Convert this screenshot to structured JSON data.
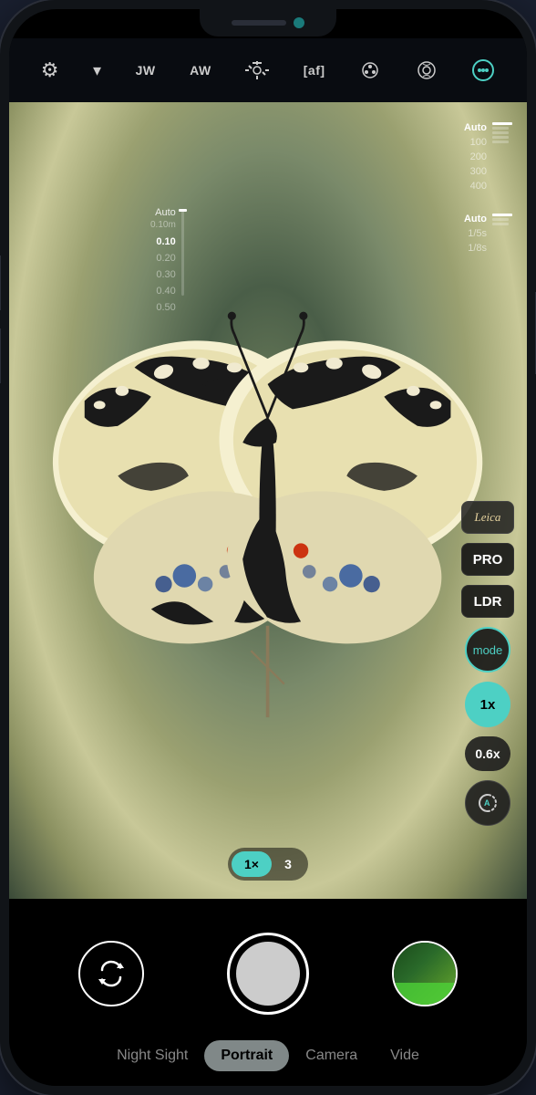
{
  "phone": {
    "notch": {
      "speaker_label": "speaker",
      "camera_label": "front-camera"
    }
  },
  "toolbar": {
    "icons": [
      {
        "id": "settings",
        "symbol": "⚙",
        "label": "Settings",
        "active": false
      },
      {
        "id": "dropdown",
        "symbol": "▾",
        "label": "Dropdown",
        "active": false
      },
      {
        "id": "jw",
        "symbol": "JW",
        "label": "White Balance JW",
        "active": false
      },
      {
        "id": "aw",
        "symbol": "AW",
        "label": "Auto White AW",
        "active": false
      },
      {
        "id": "exposure",
        "symbol": "☀",
        "label": "Exposure",
        "active": false
      },
      {
        "id": "af",
        "symbol": "[af]",
        "label": "Autofocus",
        "active": false
      },
      {
        "id": "macro",
        "symbol": "✿",
        "label": "Macro",
        "active": false
      },
      {
        "id": "lens",
        "symbol": "◉",
        "label": "Lens",
        "active": false
      },
      {
        "id": "more",
        "symbol": "⊕",
        "label": "More",
        "active": true
      }
    ]
  },
  "iso_slider": {
    "labels": [
      "Auto",
      "100",
      "200",
      "300",
      "400"
    ],
    "active_index": 0
  },
  "shutter_slider": {
    "labels": [
      "Auto",
      "1/5s",
      "1/8s"
    ],
    "active_index": 0
  },
  "focus_slider": {
    "title": "Auto",
    "subtitle": "0.10m",
    "values": [
      "0.10",
      "0.20",
      "0.30",
      "0.40",
      "0.50"
    ],
    "active_index": 0
  },
  "right_buttons": {
    "leica": "Leica",
    "pro": "PRO",
    "ldr": "LDR",
    "mode": "mode",
    "zoom_1x": "1x",
    "zoom_06x": "0.6x",
    "auto_icon": "A"
  },
  "zoom_toggle": {
    "active_label": "1×",
    "inactive_label": "3"
  },
  "shutter_controls": {
    "flip_label": "↺",
    "shutter_label": "",
    "gallery_label": ""
  },
  "mode_tabs": [
    {
      "id": "night-sight",
      "label": "Night Sight",
      "active": false
    },
    {
      "id": "portrait",
      "label": "Portrait",
      "active": true
    },
    {
      "id": "camera",
      "label": "Camera",
      "active": false
    },
    {
      "id": "video",
      "label": "Vide",
      "active": false
    }
  ],
  "colors": {
    "teal": "#4dd0c4",
    "dark_bg": "#000000",
    "toolbar_bg": "rgba(10,14,20,0.85)"
  }
}
